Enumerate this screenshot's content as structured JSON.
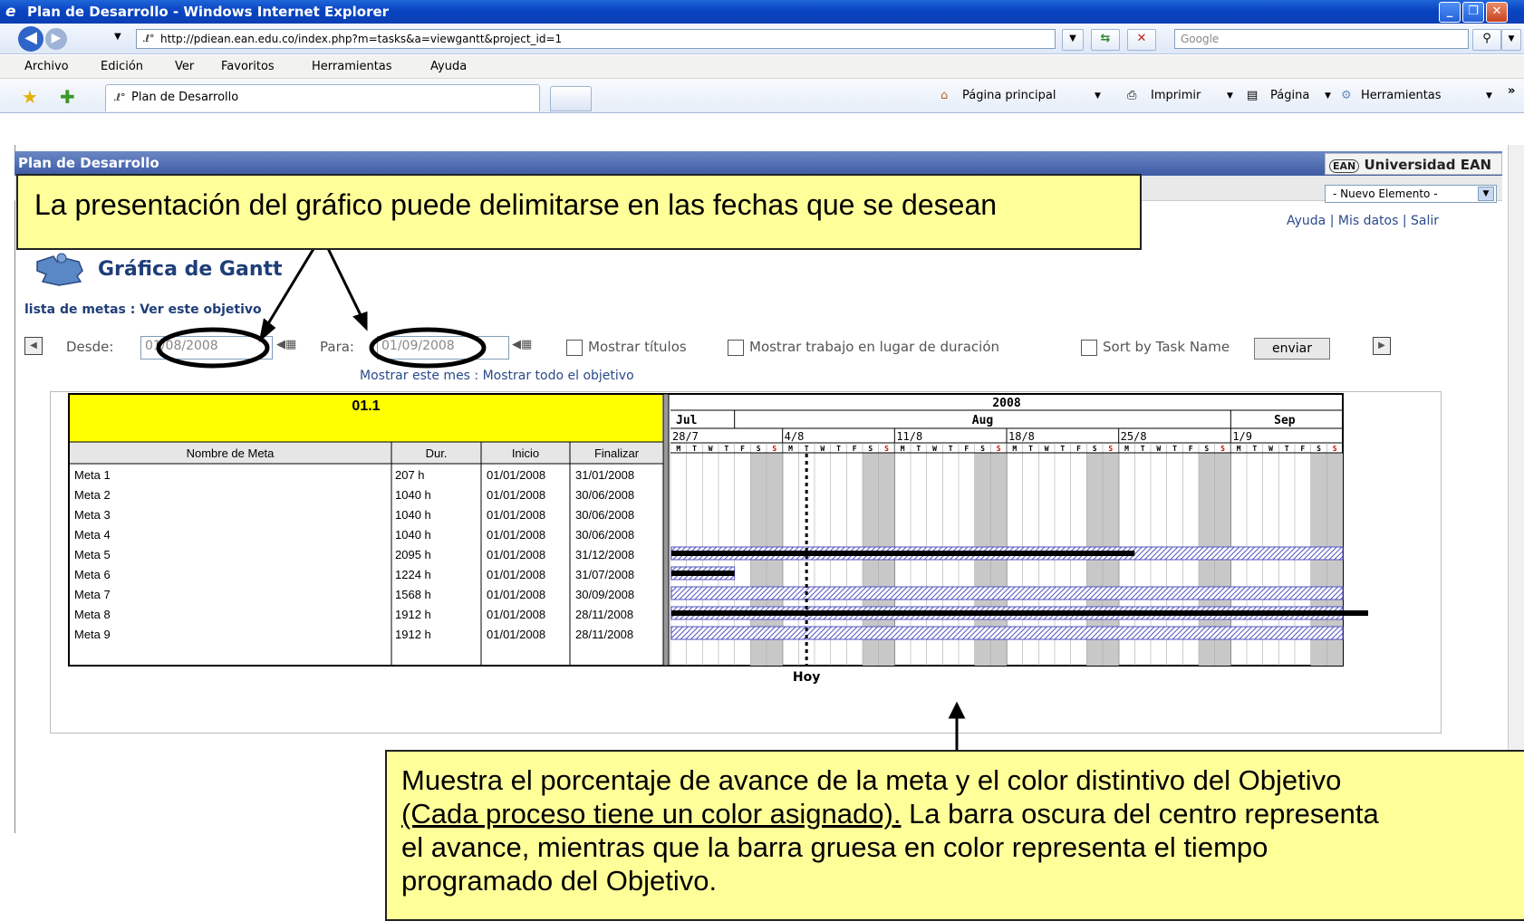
{
  "window": {
    "title": "Plan de Desarrollo - Windows Internet Explorer"
  },
  "address": {
    "url": "http://pdiean.ean.edu.co/index.php?m=tasks&a=viewgantt&project_id=1",
    "search_placeholder": "Google"
  },
  "menu": [
    "Archivo",
    "Edición",
    "Ver",
    "Favoritos",
    "Herramientas",
    "Ayuda"
  ],
  "tab": {
    "label": "Plan de Desarrollo"
  },
  "command_bar": {
    "home": "Página principal",
    "print": "Imprimir",
    "page": "Página",
    "tools": "Herramientas"
  },
  "page": {
    "header": "Plan de Desarrollo",
    "logo": "Universidad EAN",
    "new_element": "- Nuevo Elemento -",
    "links": "Ayuda | Mis datos | Salir",
    "title": "Gráfica de Gantt",
    "breadcrumb": "lista de metas : Ver este objetivo",
    "controls": {
      "desde_label": "Desde:",
      "desde_value": "01/08/2008",
      "para_label": "Para:",
      "para_value": "01/09/2008",
      "mostrar_titulos": "Mostrar títulos",
      "mostrar_trabajo": "Mostrar trabajo en lugar de duración",
      "sort_by": "Sort by Task Name",
      "enviar": "enviar"
    },
    "mostrar_links": "Mostrar este mes : Mostrar todo el objetivo"
  },
  "gantt": {
    "project": "01.1",
    "year": "2008",
    "months": [
      "Jul",
      "Aug",
      "Sep"
    ],
    "weeks": [
      "28/7",
      "4/8",
      "11/8",
      "18/8",
      "25/8",
      "1/9"
    ],
    "day_letters": [
      "M",
      "T",
      "W",
      "T",
      "F",
      "S",
      "S"
    ],
    "columns": [
      "Nombre de Meta",
      "Dur.",
      "Inicio",
      "Finalizar"
    ],
    "today_label": "Hoy",
    "colors": {
      "header_yellow": "#ffff00",
      "bar_blue": "#5050c0",
      "weekend_gray": "#c8c8c8"
    },
    "tasks": [
      {
        "name": "Meta 1",
        "dur": "207 h",
        "start": "01/01/2008",
        "end": "31/01/2008",
        "bar": false,
        "progress_end": null
      },
      {
        "name": "Meta 2",
        "dur": "1040 h",
        "start": "01/01/2008",
        "end": "30/06/2008",
        "bar": false,
        "progress_end": null
      },
      {
        "name": "Meta 3",
        "dur": "1040 h",
        "start": "01/01/2008",
        "end": "30/06/2008",
        "bar": false,
        "progress_end": null
      },
      {
        "name": "Meta 4",
        "dur": "1040 h",
        "start": "01/01/2008",
        "end": "30/06/2008",
        "bar": false,
        "progress_end": null
      },
      {
        "name": "Meta 5",
        "dur": "2095 h",
        "start": "01/01/2008",
        "end": "31/12/2008",
        "bar": true,
        "progress_end": "2008-08-25"
      },
      {
        "name": "Meta 6",
        "dur": "1224 h",
        "start": "01/01/2008",
        "end": "31/07/2008",
        "bar": true,
        "progress_end": "2008-07-31"
      },
      {
        "name": "Meta 7",
        "dur": "1568 h",
        "start": "01/01/2008",
        "end": "30/09/2008",
        "bar": true,
        "progress_end": null
      },
      {
        "name": "Meta 8",
        "dur": "1912 h",
        "start": "01/01/2008",
        "end": "28/11/2008",
        "bar": true,
        "progress_end": "2008-09-30"
      },
      {
        "name": "Meta 9",
        "dur": "1912 h",
        "start": "01/01/2008",
        "end": "28/11/2008",
        "bar": true,
        "progress_end": null
      }
    ]
  },
  "callouts": {
    "top": "La presentación del gráfico puede delimitarse en las fechas que se desean",
    "bottom_1": "Muestra el porcentaje de avance de la meta y el color distintivo del Objetivo",
    "bottom_2_underlined": "(Cada proceso tiene un color asignado).",
    "bottom_2_rest": " La barra oscura del centro representa",
    "bottom_3": "el avance, mientras que la barra gruesa en color representa el tiempo",
    "bottom_4": "programado del Objetivo."
  }
}
